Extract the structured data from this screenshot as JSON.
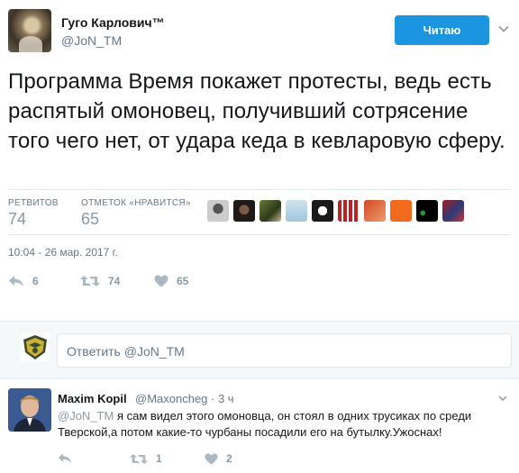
{
  "tweet": {
    "author_name": "Гуго Карлович™",
    "author_handle": "@JoN_TM",
    "follow_label": "Читаю",
    "text": "Программа Время покажет протесты, ведь есть распятый омоновец, получивший сотрясение того чего нет, от удара кеда в кевларовую сферу.",
    "retweets_label": "РЕТВИТОВ",
    "retweets_count": "74",
    "likes_label": "ОТМЕТОК «НРАВИТСЯ»",
    "likes_count": "65",
    "timestamp": "10:04 - 26 мар. 2017 г.",
    "action_counts": {
      "reply": "6",
      "retweet": "74",
      "like": "65"
    }
  },
  "reply_box": {
    "placeholder": "Ответить @JoN_TM"
  },
  "reply": {
    "author_name": "Maxim Kopil",
    "author_handle": "@Maxoncheg",
    "time": "· 3 ч",
    "mention": "@JoN_TM",
    "text": " я сам видел этого омоновца, он стоял в одних трусиках по среди Тверской,а потом какие-то чурбаны посадили его на бутылку.Ужоснах!",
    "action_counts": {
      "reply": "",
      "retweet": "1",
      "like": "2"
    }
  },
  "colors": {
    "accent": "#1b95e0",
    "muted": "#8899a6",
    "text": "#14171a",
    "secondary": "#657786"
  },
  "liker_avatars": [
    "liker-1",
    "liker-2",
    "liker-3",
    "liker-4",
    "liker-5",
    "liker-6",
    "liker-7",
    "liker-8",
    "liker-9",
    "liker-10"
  ]
}
